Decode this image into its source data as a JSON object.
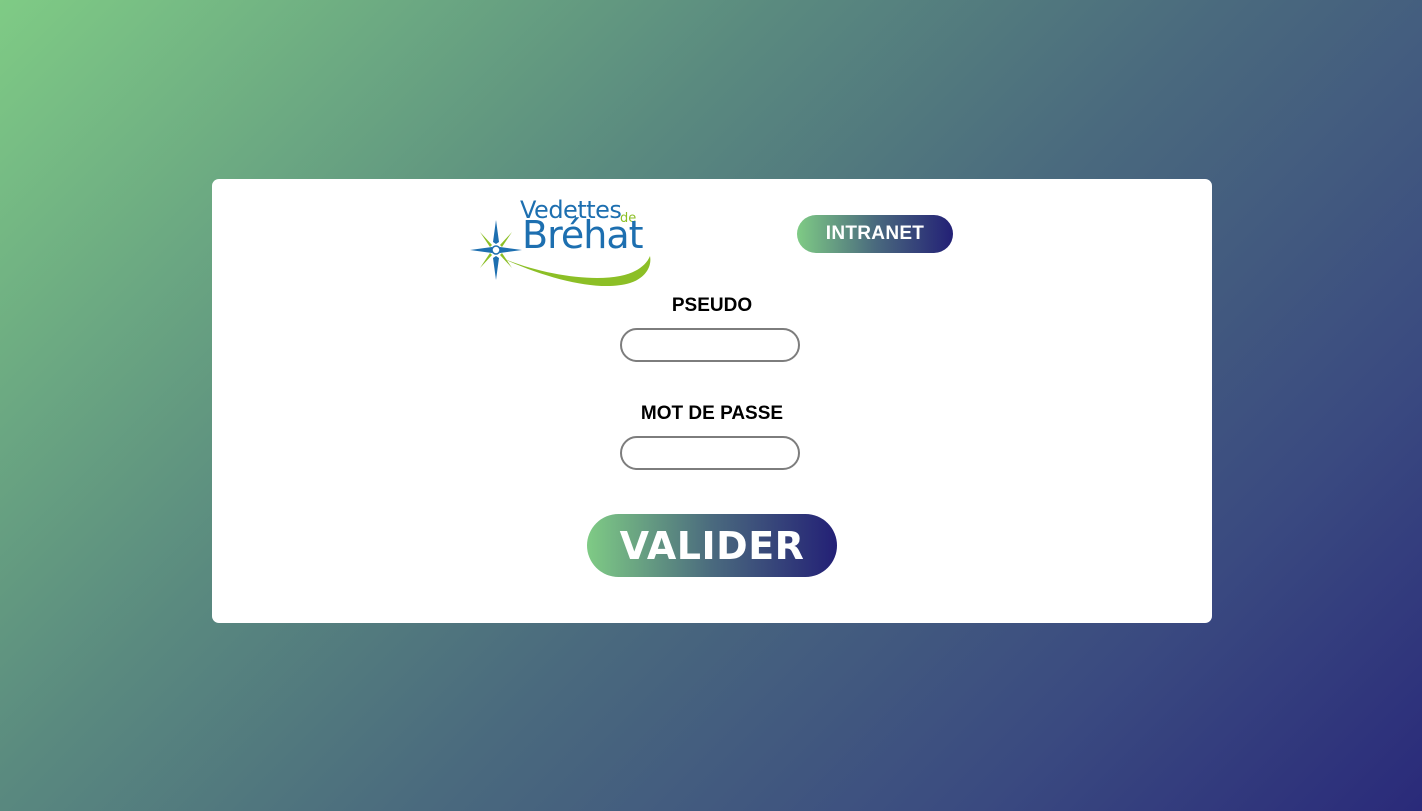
{
  "logo": {
    "line1": "Vedettes",
    "line_de": "de",
    "line2": "Bréhat",
    "colors": {
      "text": "#1d6fb0",
      "accent": "#8cbf26"
    }
  },
  "header": {
    "badge_label": "INTRANET"
  },
  "form": {
    "pseudo_label": "PSEUDO",
    "pseudo_value": "",
    "password_label": "MOT DE PASSE",
    "password_value": "",
    "submit_label": "VALIDER"
  },
  "theme": {
    "gradient_start": "#7fcb85",
    "gradient_end": "#232076",
    "card_background": "#ffffff",
    "input_border": "#7d7d7d"
  }
}
